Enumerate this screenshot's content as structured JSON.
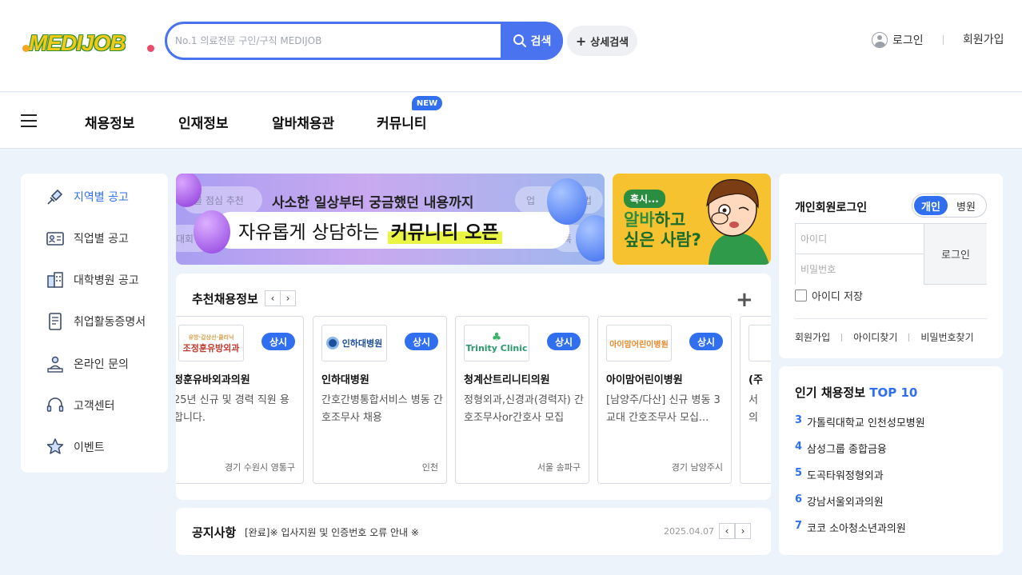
{
  "header": {
    "logo_text": "MEDIJOB",
    "search_placeholder": "No.1 의료전문 구인/구직 MEDIJOB",
    "search_button": "검색",
    "advanced_search": "상세검색",
    "login": "로그인",
    "join": "회원가입"
  },
  "gnb": {
    "items": [
      "채용정보",
      "인재정보",
      "알바채용관",
      "커뮤니티"
    ],
    "new_badge": "NEW"
  },
  "sidebar": {
    "items": [
      {
        "label": "지역별 공고",
        "icon": "pin-map-icon",
        "active": true
      },
      {
        "label": "직업별 공고",
        "icon": "id-card-icon"
      },
      {
        "label": "대학병원 공고",
        "icon": "building-icon"
      },
      {
        "label": "취업활동증명서",
        "icon": "document-icon"
      },
      {
        "label": "온라인 문의",
        "icon": "person-board-icon"
      },
      {
        "label": "고객센터",
        "icon": "headset-icon"
      },
      {
        "label": "이벤트",
        "icon": "star-icon"
      }
    ]
  },
  "banner": {
    "ghost_pills": [
      "골 점심 추천",
      "업",
      "법",
      "대회",
      "특"
    ],
    "line1": "사소한 일상부터 궁금했던 내용까지",
    "line2_prefix": "자유롭게 상담하는",
    "line2_highlight": "커뮤니티 오픈"
  },
  "side_banner": {
    "tag": "혹시...",
    "line1_hl": "알바",
    "line1_rest": "하고",
    "line2": "싶은 사람?"
  },
  "recommend": {
    "title": "추천채용정보",
    "prev": "‹",
    "next": "›",
    "more": "+",
    "cards": [
      {
        "logo": "조정훈유방외과",
        "badge": "상시",
        "name": "정훈유바외과의원",
        "desc": "25년 신규 및 경력 직원 용합니다.",
        "location": "경기 수원시 영통구"
      },
      {
        "logo": "인하대병원",
        "badge": "상시",
        "name": "인하대병원",
        "desc": "간호간병통합서비스 병동 간호조무사 채용",
        "location": "인천"
      },
      {
        "logo": "Trinity Clinic",
        "badge": "상시",
        "name": "청계산트리니티의원",
        "desc": "정형외과,신경과(경력자) 간호조무사or간호사 모집",
        "location": "서울 송파구"
      },
      {
        "logo": "아이맘어린이병원",
        "badge": "상시",
        "name": "아이맘어린이병원",
        "desc": "[남양주/다산] 신규 병동 3교대 간호조무사 모십...",
        "location": "경기 남양주시"
      },
      {
        "logo": "",
        "badge": "",
        "name": "(주",
        "desc": "서 의",
        "location": ""
      }
    ]
  },
  "notice": {
    "title": "공지사항",
    "text": "[완료]※ 입사지원 및 인증번호 오류 안내 ※",
    "date": "2025.04.07"
  },
  "login_panel": {
    "title": "개인회원로그인",
    "toggle": [
      "개인",
      "병원"
    ],
    "id_placeholder": "아이디",
    "pw_placeholder": "비밀번호",
    "login_button": "로그인",
    "save_id": "아이디 저장",
    "links": [
      "회원가입",
      "아이디찾기",
      "비밀번호찾기"
    ]
  },
  "top10": {
    "title": "인기 채용정보",
    "title_accent": "TOP 10",
    "items": [
      {
        "rank": "3",
        "name": "가톨릭대학교 인천성모병원"
      },
      {
        "rank": "4",
        "name": "삼성그룹 종합금융"
      },
      {
        "rank": "5",
        "name": "도곡타워정형외과"
      },
      {
        "rank": "6",
        "name": "강남서울외과의원"
      },
      {
        "rank": "7",
        "name": "코코 소아청소년과의원"
      }
    ]
  },
  "colors": {
    "accent": "#2f6ff0",
    "search_border": "#4a73f0",
    "page_bg": "#edf3fb"
  }
}
